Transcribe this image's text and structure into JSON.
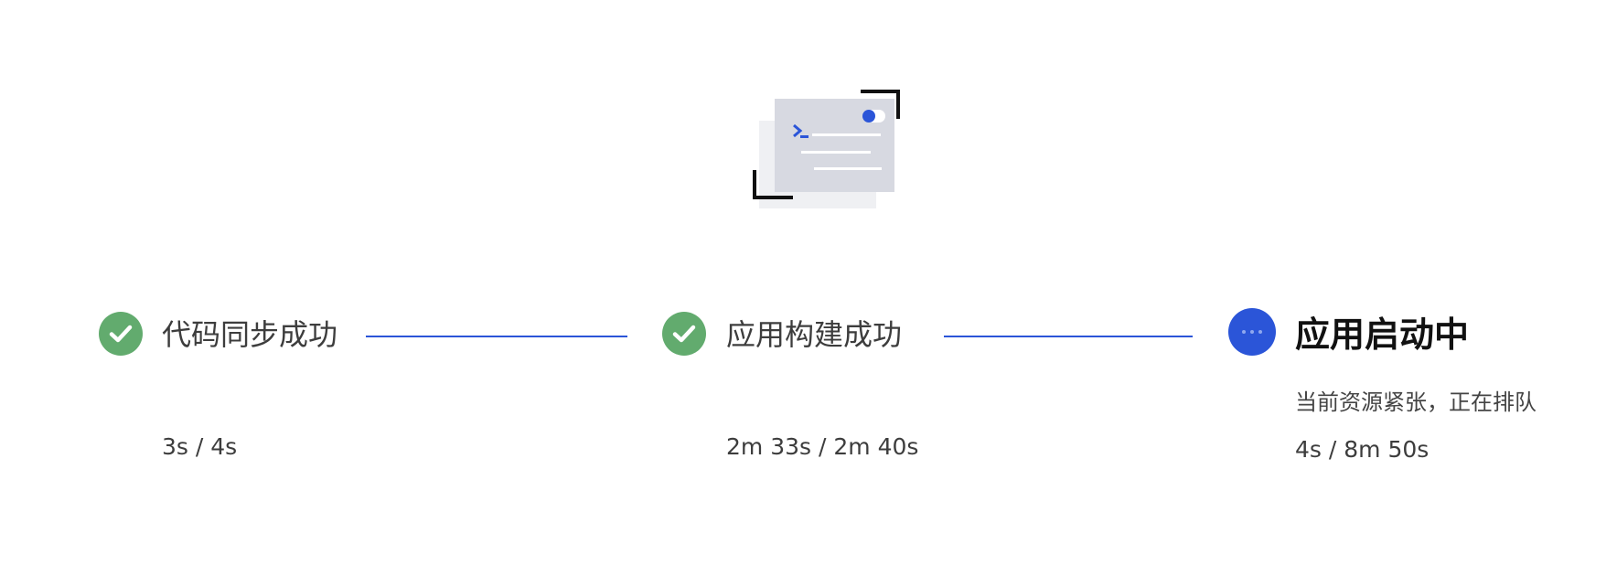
{
  "colors": {
    "success": "#62ab6e",
    "active": "#2b55d8",
    "connector": "#2b55d8",
    "illustration_card": "#d7d9e1",
    "illustration_shadow": "#eff0f3"
  },
  "illustration": {
    "icon": "terminal-card-icon"
  },
  "steps": [
    {
      "status": "success",
      "icon": "check-icon",
      "title": "代码同步成功",
      "duration": "3s / 4s"
    },
    {
      "status": "success",
      "icon": "check-icon",
      "title": "应用构建成功",
      "duration": "2m 33s / 2m 40s"
    },
    {
      "status": "running",
      "icon": "more-dots-icon",
      "title": "应用启动中",
      "note": "当前资源紧张，正在排队",
      "duration": "4s / 8m 50s"
    }
  ]
}
